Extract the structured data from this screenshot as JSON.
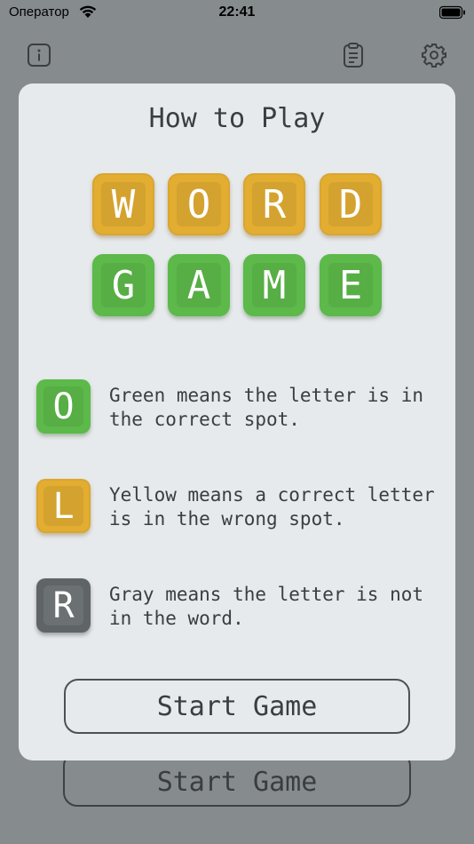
{
  "status_bar": {
    "carrier": "Оператор",
    "time": "22:41"
  },
  "toolbar": {
    "info_icon": "info-icon",
    "clipboard_icon": "clipboard-icon",
    "settings_icon": "gear-icon"
  },
  "background": {
    "start_button": "Start Game"
  },
  "modal": {
    "title": "How to Play",
    "word_row_1": [
      "W",
      "O",
      "R",
      "D"
    ],
    "word_row_2": [
      "G",
      "A",
      "M",
      "E"
    ],
    "rules": [
      {
        "letter": "O",
        "color": "green",
        "text": "Green means the letter is in the correct spot."
      },
      {
        "letter": "L",
        "color": "yellow",
        "text": "Yellow means a correct letter is in the wrong spot."
      },
      {
        "letter": "R",
        "color": "gray",
        "text": "Gray means the letter is not in the word."
      }
    ],
    "start_button": "Start Game"
  },
  "colors": {
    "green": "#5cb94a",
    "yellow": "#e2ad31",
    "gray": "#5f6467",
    "modal_bg": "#e7eaed",
    "overlay": "#868b8e"
  }
}
